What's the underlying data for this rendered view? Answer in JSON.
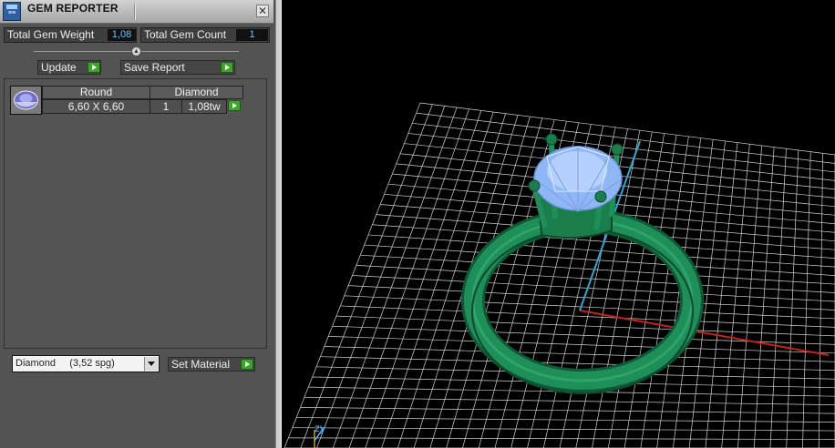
{
  "window": {
    "title": "GEM REPORTER",
    "close_glyph": "✕",
    "icon": "gem-reporter-app-icon"
  },
  "stats": {
    "total_weight_label": "Total Gem Weight",
    "total_weight_value": "1,08",
    "total_count_label": "Total Gem Count",
    "total_count_value": "1"
  },
  "actions": {
    "update_label": "Update",
    "save_report_label": "Save Report"
  },
  "table": {
    "headers": [
      "Round",
      "Diamond"
    ],
    "rows": [
      {
        "size": "6,60 X 6,60",
        "qty": "1",
        "weight": "1,08tw"
      }
    ]
  },
  "material": {
    "selected": "Diamond     (3,52 spg)",
    "set_label": "Set Material"
  },
  "viewport": {
    "axis_label": "zy"
  },
  "colors": {
    "ring": "#1f8f5a",
    "gem": "#9ec4ff",
    "grid": "#d0d0d0",
    "axis_x": "#c0241c",
    "axis_y": "#2aa8d8"
  }
}
